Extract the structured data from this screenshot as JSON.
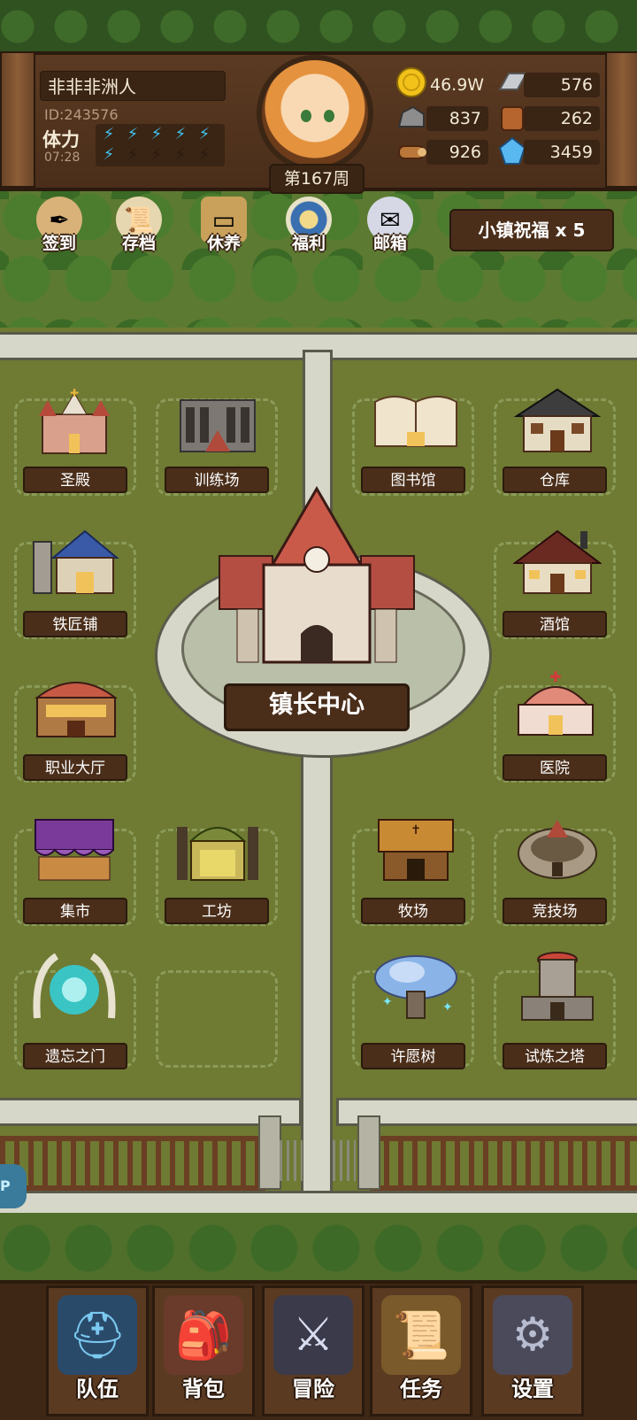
{
  "player": {
    "name": "非非非洲人",
    "id": "ID:243576",
    "stamina_label": "体力",
    "stamina_timer": "07:28",
    "stamina_filled": 6,
    "stamina_max": 10,
    "week": "第167周"
  },
  "resources": {
    "gold": "46.9W",
    "iron": "576",
    "stone": "837",
    "leather": "262",
    "wood": "926",
    "crystal": "3459"
  },
  "toolbar": {
    "items": [
      {
        "label": "签到",
        "icon": "quill-icon"
      },
      {
        "label": "存档",
        "icon": "scroll-feather-icon"
      },
      {
        "label": "休养",
        "icon": "sign-board-icon"
      },
      {
        "label": "福利",
        "icon": "shield-badge-icon"
      },
      {
        "label": "邮箱",
        "icon": "mail-icon"
      }
    ],
    "blessing": "小镇祝福 x 5"
  },
  "buildings": {
    "holy_hall": "圣殿",
    "training_ground": "训练场",
    "library": "图书馆",
    "warehouse": "仓库",
    "blacksmith": "铁匠铺",
    "tavern": "酒馆",
    "town_center": "镇长中心",
    "job_hall": "职业大厅",
    "hospital": "医院",
    "market": "集市",
    "workshop": "工坊",
    "ranch": "牧场",
    "arena": "竞技场",
    "forgotten_gate": "遗忘之门",
    "wish_tree": "许愿树",
    "trial_tower": "试炼之塔"
  },
  "side_tab": "P",
  "nav": {
    "team": "队伍",
    "bag": "背包",
    "adventure": "冒险",
    "quest": "任务",
    "settings": "设置"
  },
  "colors": {
    "grass": "#6f7a33",
    "wood_dark": "#4a2e1a",
    "road": "#d6d7c9",
    "stamina_on": "#3fc4f0"
  }
}
